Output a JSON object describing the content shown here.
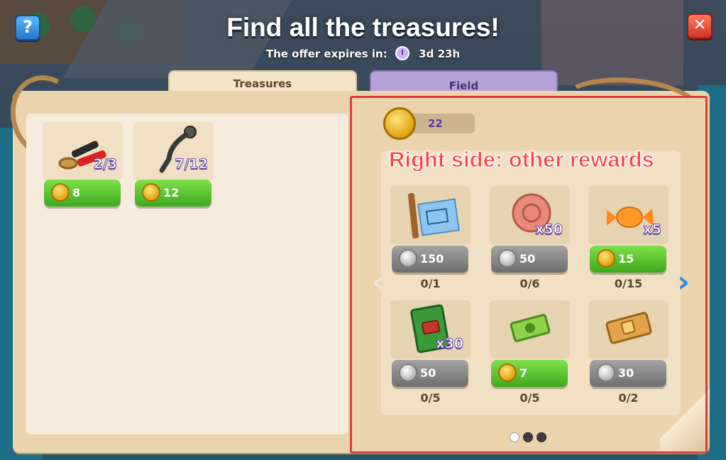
{
  "header": {
    "title": "Find all the treasures!",
    "expiry_label": "The offer expires in:",
    "expiry_value": "3d 23h",
    "help_label": "?",
    "close_label": "✕"
  },
  "tabs": [
    {
      "label": "Treasures",
      "active": true
    },
    {
      "label": "Field",
      "active": false
    }
  ],
  "treasures": [
    {
      "icon": "battery-clamp-icon",
      "count": "2/3",
      "price": "8",
      "currency": "gold"
    },
    {
      "icon": "wrench-part-icon",
      "count": "7/12",
      "price": "12",
      "currency": "gold"
    }
  ],
  "balance": {
    "value": "22",
    "currency": "gold"
  },
  "annotation": "Right side: other rewards",
  "rewards": [
    {
      "icon": "blueprint-icon",
      "multiplier": "",
      "price": "150",
      "currency": "silver",
      "progress": "0/1"
    },
    {
      "icon": "red-token-icon",
      "multiplier": "x50",
      "price": "50",
      "currency": "silver",
      "progress": "0/6"
    },
    {
      "icon": "candy-icon",
      "multiplier": "x5",
      "price": "15",
      "currency": "gold",
      "progress": "0/15"
    },
    {
      "icon": "green-book-icon",
      "multiplier": "x30",
      "price": "50",
      "currency": "silver",
      "progress": "0/5"
    },
    {
      "icon": "cash-icon",
      "multiplier": "",
      "price": "7",
      "currency": "gold",
      "progress": "0/5"
    },
    {
      "icon": "ticket-icon",
      "multiplier": "",
      "price": "30",
      "currency": "silver",
      "progress": "0/2"
    }
  ],
  "pagination": {
    "pages": 3,
    "current": 1
  },
  "colors": {
    "accent_green": "#3ea81d",
    "accent_gray": "#6e6e6e",
    "highlight": "#e13a3a",
    "annotation": "#ff4040"
  }
}
